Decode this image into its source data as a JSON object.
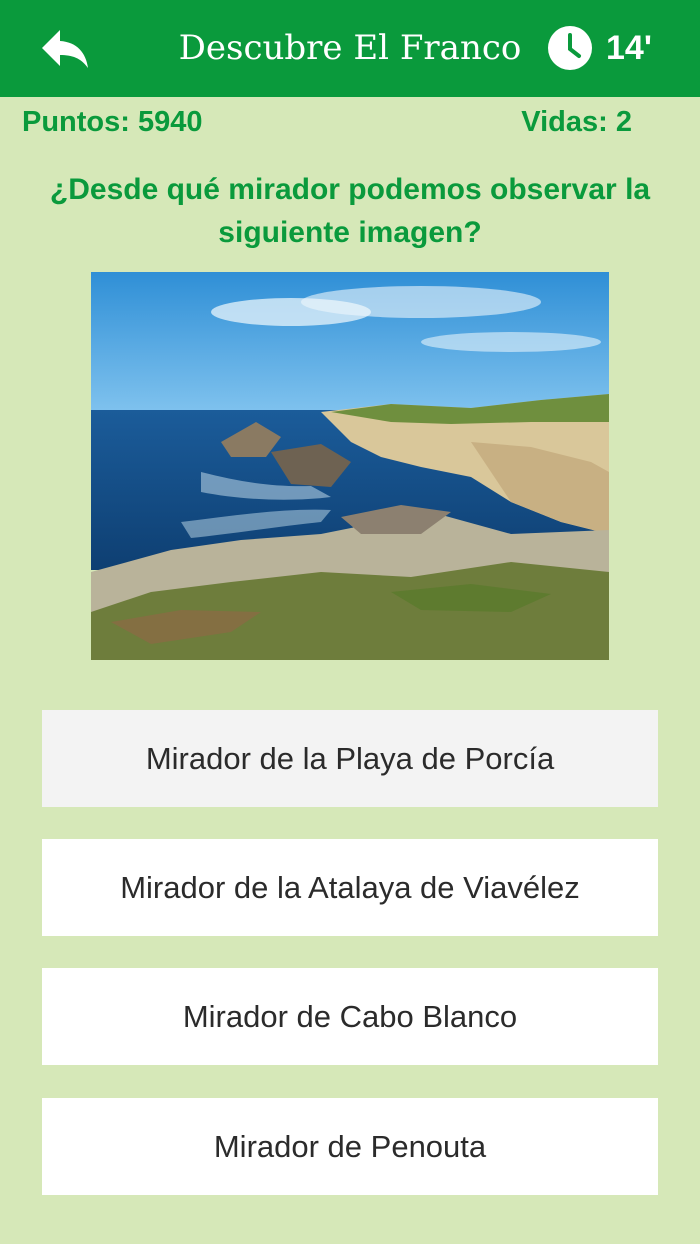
{
  "header": {
    "title": "Descubre El Franco",
    "timer": "14'",
    "back_icon": "back-arrow-icon",
    "clock_icon": "clock-icon",
    "color": "#0a9a3c"
  },
  "stats": {
    "points": "Puntos: 5940",
    "lives": "Vidas: 2"
  },
  "question": "¿Desde qué mirador podemos observar la siguiente imagen?",
  "answers": [
    {
      "label": "Mirador de la Playa de Porcía",
      "selected": true
    },
    {
      "label": "Mirador de la Atalaya de Viavélez",
      "selected": false
    },
    {
      "label": "Mirador de Cabo Blanco",
      "selected": false
    },
    {
      "label": "Mirador de Penouta",
      "selected": false
    }
  ]
}
